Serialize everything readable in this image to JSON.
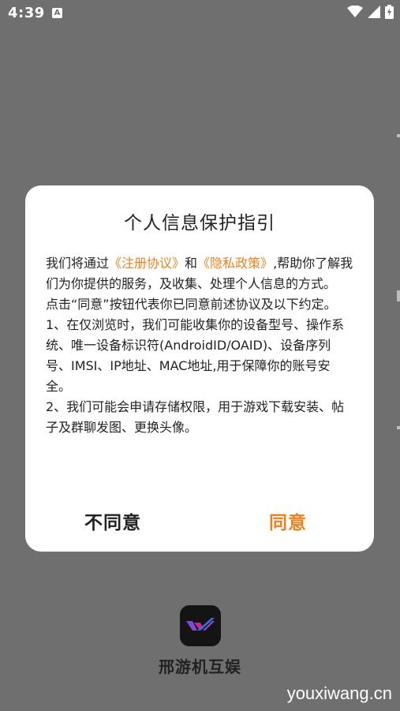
{
  "status_bar": {
    "time": "4:39",
    "notification_icon": "a-icon"
  },
  "dialog": {
    "title": "个人信息保护指引",
    "body": {
      "p1_prefix": "我们将通过",
      "link_register": "《注册协议》",
      "p1_and": "和",
      "link_privacy": "《隐私政策》",
      "p1_suffix": ",帮助你了解我们为你提供的服务，及收集、处理个人信息的方式。",
      "p2": " 点击“同意”按钮代表你已同意前述协议及以下约定。",
      "p3": " 1、在仅浏览时，我们可能收集你的设备型号、操作系统、唯一设备标识符(AndroidID/OAID)、设备序列号、IMSI、IP地址、MAC地址,用于保障你的账号安全。",
      "p4": " 2、我们可能会申请存储权限，用于游戏下载安装、帖子及群聊发图、更换头像。"
    },
    "disagree_label": "不同意",
    "agree_label": "同意"
  },
  "app": {
    "name": "邢游机互娱"
  },
  "watermark": "youxiwang.cn",
  "colors": {
    "accent": "#e8811f",
    "overlay": "#6f6f6f"
  }
}
